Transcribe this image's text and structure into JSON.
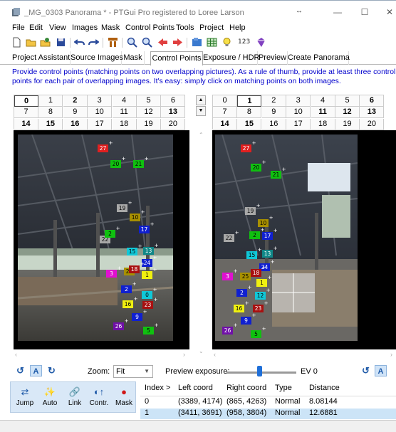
{
  "window": {
    "title": "_MG_0303 Panorama * - PTGui Pro registered to Loree Larson",
    "minimize_glyph": "—",
    "maximize_glyph": "☐",
    "close_glyph": "✕",
    "resize_glyph": "↔"
  },
  "menu": [
    "File",
    "Edit",
    "View",
    "Images",
    "Mask",
    "Control Points",
    "Tools",
    "Project",
    "Help"
  ],
  "toolbar": {
    "counter_label": "123"
  },
  "tabs": {
    "items": [
      "Project Assistant",
      "Source Images",
      "Mask",
      "Control Points",
      "Exposure / HDR",
      "Preview",
      "Create Panorama"
    ],
    "active": "Control Points"
  },
  "hint": {
    "line1": "Provide control points (matching points on two overlapping pictures). As a rule of thumb, provide at least three control",
    "line2": "points for each pair of overlapping images. It's easy: simply click on matching points on both images."
  },
  "image_grid_left": {
    "rows": [
      [
        "0",
        "1",
        "2",
        "3",
        "4",
        "5",
        "6"
      ],
      [
        "7",
        "8",
        "9",
        "10",
        "11",
        "12",
        "13"
      ],
      [
        "14",
        "15",
        "16",
        "17",
        "18",
        "19",
        "20"
      ]
    ],
    "selected": "0",
    "bold": [
      "0",
      "2",
      "13",
      "14",
      "15",
      "16"
    ]
  },
  "image_grid_right": {
    "rows": [
      [
        "0",
        "1",
        "2",
        "3",
        "4",
        "5",
        "6"
      ],
      [
        "7",
        "8",
        "9",
        "10",
        "11",
        "12",
        "13"
      ],
      [
        "14",
        "15",
        "16",
        "17",
        "18",
        "19",
        "20"
      ]
    ],
    "selected": "1",
    "bold": [
      "1",
      "6",
      "11",
      "12",
      "13",
      "14",
      "15"
    ]
  },
  "control_points": {
    "left": [
      "27",
      "20",
      "21",
      "19",
      "10",
      "17",
      "22",
      "2",
      "15",
      "13",
      "24",
      "3",
      "25",
      "1",
      "18",
      "2",
      "0",
      "16",
      "23",
      "9",
      "26",
      "5"
    ],
    "right": [
      "27",
      "20",
      "21",
      "19",
      "10",
      "17",
      "22",
      "2",
      "15",
      "13",
      "24",
      "3",
      "25",
      "1",
      "18",
      "2",
      "12",
      "16",
      "23",
      "9",
      "26",
      "5"
    ]
  },
  "point_colors": {
    "red": "#e02020",
    "green": "#10c010",
    "gray": "#a8a8a8",
    "olive": "#a89000",
    "blue": "#1020d0",
    "cyan": "#10c8d8",
    "teal": "#108888",
    "magenta": "#e010d0",
    "yellow": "#f0f010",
    "purple": "#7010a8",
    "darkred": "#a81010",
    "gray2": "#808080"
  },
  "bottom": {
    "zoom_label": "Zoom:",
    "zoom_value": "Fit",
    "preview_exposure_label": "Preview exposure:",
    "ev_value": "EV 0",
    "preview_exposure_level": 0.47
  },
  "cp_panel": {
    "buttons": [
      {
        "label": "Jump",
        "icon": "jump-icon"
      },
      {
        "label": "Auto",
        "icon": "auto-icon"
      },
      {
        "label": "Link",
        "icon": "link-icon"
      },
      {
        "label": "Contr.",
        "icon": "contrast-icon"
      },
      {
        "label": "Mask",
        "icon": "mask-icon"
      }
    ]
  },
  "cp_table": {
    "headers": [
      "Index >",
      "Left coord",
      "Right coord",
      "Type",
      "Distance"
    ],
    "rows": [
      [
        "0",
        "(3389, 4174)",
        "(865, 4263)",
        "Normal",
        "8.08144"
      ],
      [
        "1",
        "(3411, 3691)",
        "(958, 3804)",
        "Normal",
        "12.6881"
      ]
    ]
  }
}
